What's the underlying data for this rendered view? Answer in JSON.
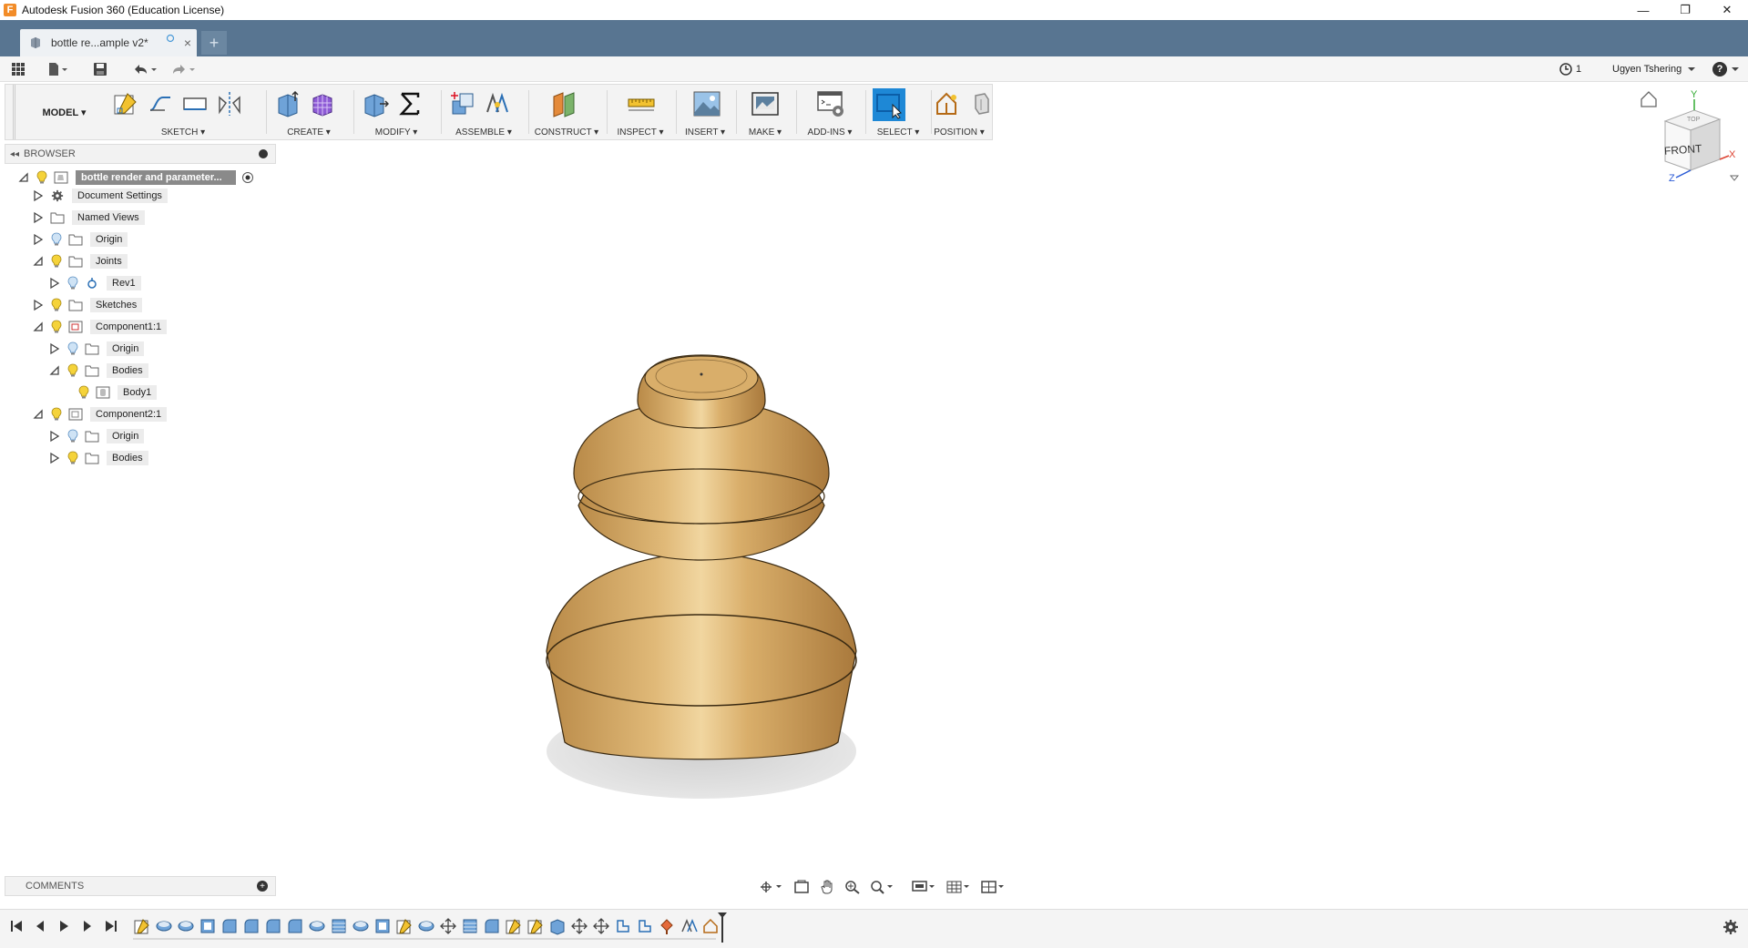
{
  "window": {
    "title": "Autodesk Fusion 360 (Education License)",
    "app_logo": "F",
    "controls": [
      "—",
      "❐",
      "✕"
    ]
  },
  "tabs": {
    "active_label": "bottle re...ample v2*",
    "close_glyph": "×",
    "new_tab_glyph": "+"
  },
  "quickbar": {
    "job_count": "1",
    "user_name": "Ugyen Tshering",
    "help_glyph": "?"
  },
  "toolbar": {
    "mode_label": "MODEL ▾",
    "groups": {
      "sketch": "SKETCH ▾",
      "create": "CREATE ▾",
      "modify": "MODIFY ▾",
      "assemble": "ASSEMBLE ▾",
      "construct": "CONSTRUCT ▾",
      "inspect": "INSPECT ▾",
      "insert": "INSERT ▾",
      "make": "MAKE ▾",
      "addins": "ADD-INS ▾",
      "select": "SELECT ▾",
      "position": "POSITION ▾"
    }
  },
  "browser": {
    "title": "BROWSER",
    "collapse_glyph": "◂◂",
    "items": [
      {
        "label": "bottle render and parameter..."
      },
      {
        "label": "Document Settings"
      },
      {
        "label": "Named Views"
      },
      {
        "label": "Origin"
      },
      {
        "label": "Joints"
      },
      {
        "label": "Rev1"
      },
      {
        "label": "Sketches"
      },
      {
        "label": "Component1:1"
      },
      {
        "label": "Origin"
      },
      {
        "label": "Bodies"
      },
      {
        "label": "Body1"
      },
      {
        "label": "Component2:1"
      },
      {
        "label": "Origin"
      },
      {
        "label": "Bodies"
      }
    ]
  },
  "comments": {
    "title": "COMMENTS",
    "add_glyph": "+"
  },
  "viewcube": {
    "face_label": "FRONT",
    "top_label": "TOP",
    "axis_x": "X",
    "axis_y": "Y",
    "axis_z": "Z"
  },
  "colors": {
    "tabstrip": "#587591",
    "select_active": "#1e88d6",
    "wood": "#d4a55c"
  }
}
